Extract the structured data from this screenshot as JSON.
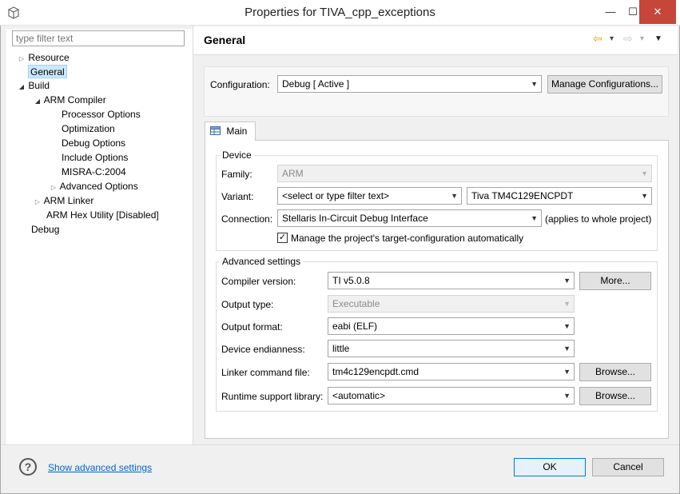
{
  "window": {
    "title": "Properties for TIVA_cpp_exceptions",
    "minimize": "—",
    "maximize": "☐",
    "close": "✕"
  },
  "filter": {
    "placeholder": "type filter text"
  },
  "tree": {
    "resource": "Resource",
    "general": "General",
    "build": "Build",
    "arm_compiler": "ARM Compiler",
    "processor_options": "Processor Options",
    "optimization": "Optimization",
    "debug_options": "Debug Options",
    "include_options": "Include Options",
    "misra": "MISRA-C:2004",
    "advanced_options": "Advanced Options",
    "arm_linker": "ARM Linker",
    "arm_hex_utility": "ARM Hex Utility  [Disabled]",
    "debug": "Debug"
  },
  "header": {
    "title": "General",
    "back": "⇦",
    "forward": "⇨",
    "dropdown": "▾",
    "menu": "▼"
  },
  "configuration": {
    "label": "Configuration:",
    "value": "Debug  [ Active ]",
    "manage_button": "Manage Configurations..."
  },
  "tab": {
    "label": "Main"
  },
  "device": {
    "group_title": "Device",
    "family_label": "Family:",
    "family_value": "ARM",
    "variant_label": "Variant:",
    "variant_filter": "<select or type filter text>",
    "variant_value": "Tiva TM4C129ENCPDT",
    "connection_label": "Connection:",
    "connection_value": "Stellaris In-Circuit Debug Interface",
    "connection_note": "(applies to whole project)",
    "manage_checkbox": "Manage the project's target-configuration automatically",
    "checkmark": "✓"
  },
  "advanced": {
    "group_title": "Advanced settings",
    "compiler_label": "Compiler version:",
    "compiler_value": "TI v5.0.8",
    "more_button": "More...",
    "output_type_label": "Output type:",
    "output_type_value": "Executable",
    "output_format_label": "Output format:",
    "output_format_value": "eabi (ELF)",
    "endianness_label": "Device endianness:",
    "endianness_value": "little",
    "linker_label": "Linker command file:",
    "linker_value": "tm4c129encpdt.cmd",
    "browse1": "Browse...",
    "runtime_label": "Runtime support library:",
    "runtime_value": "<automatic>",
    "browse2": "Browse..."
  },
  "footer": {
    "help": "?",
    "advanced_link": "Show advanced settings",
    "ok": "OK",
    "cancel": "Cancel"
  }
}
